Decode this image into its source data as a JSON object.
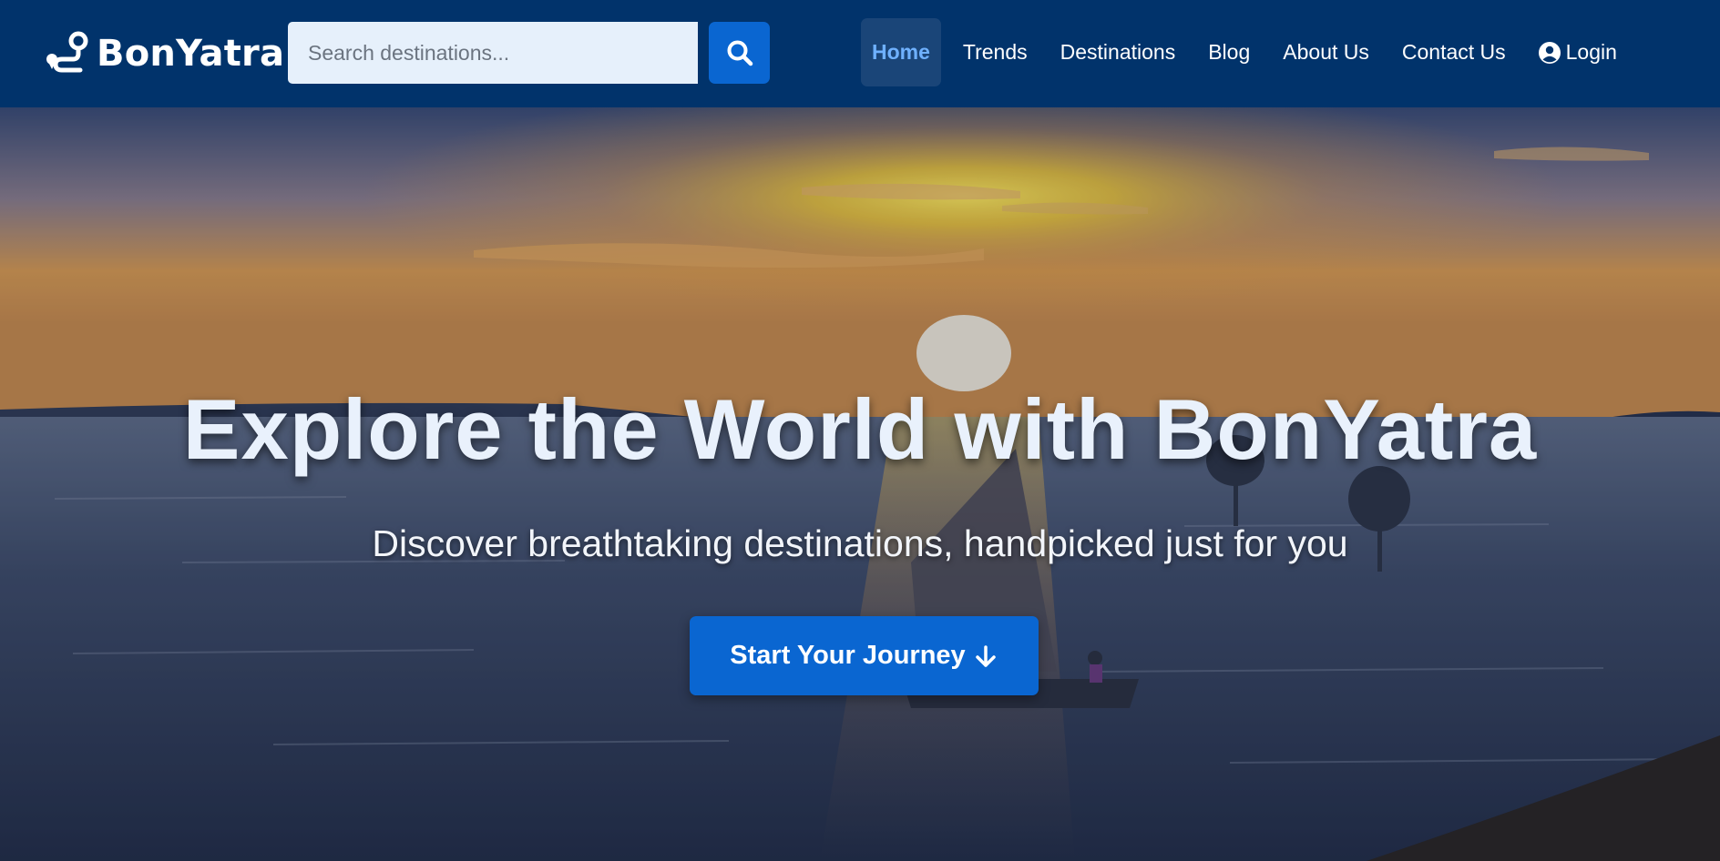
{
  "brand": {
    "name": "BonYatra",
    "icon": "route-pin-icon"
  },
  "search": {
    "placeholder": "Search destinations...",
    "value": "",
    "button_icon": "search-icon"
  },
  "nav": {
    "items": [
      {
        "label": "Home",
        "active": true
      },
      {
        "label": "Trends",
        "active": false
      },
      {
        "label": "Destinations",
        "active": false
      },
      {
        "label": "Blog",
        "active": false
      },
      {
        "label": "About Us",
        "active": false
      },
      {
        "label": "Contact Us",
        "active": false
      }
    ],
    "login": {
      "label": "Login",
      "icon": "user-circle-icon"
    }
  },
  "hero": {
    "title": "Explore the World with BonYatra",
    "subtitle": "Discover breathtaking destinations, handpicked just for you",
    "cta_label": "Start Your Journey",
    "cta_icon": "arrow-down-icon",
    "background": "sunset-sailboat-sea-image"
  },
  "colors": {
    "navbar_bg": "#01336b",
    "accent": "#0a66d1",
    "active_nav_text": "#6fb1ff",
    "search_bg": "#e6f0fb"
  }
}
